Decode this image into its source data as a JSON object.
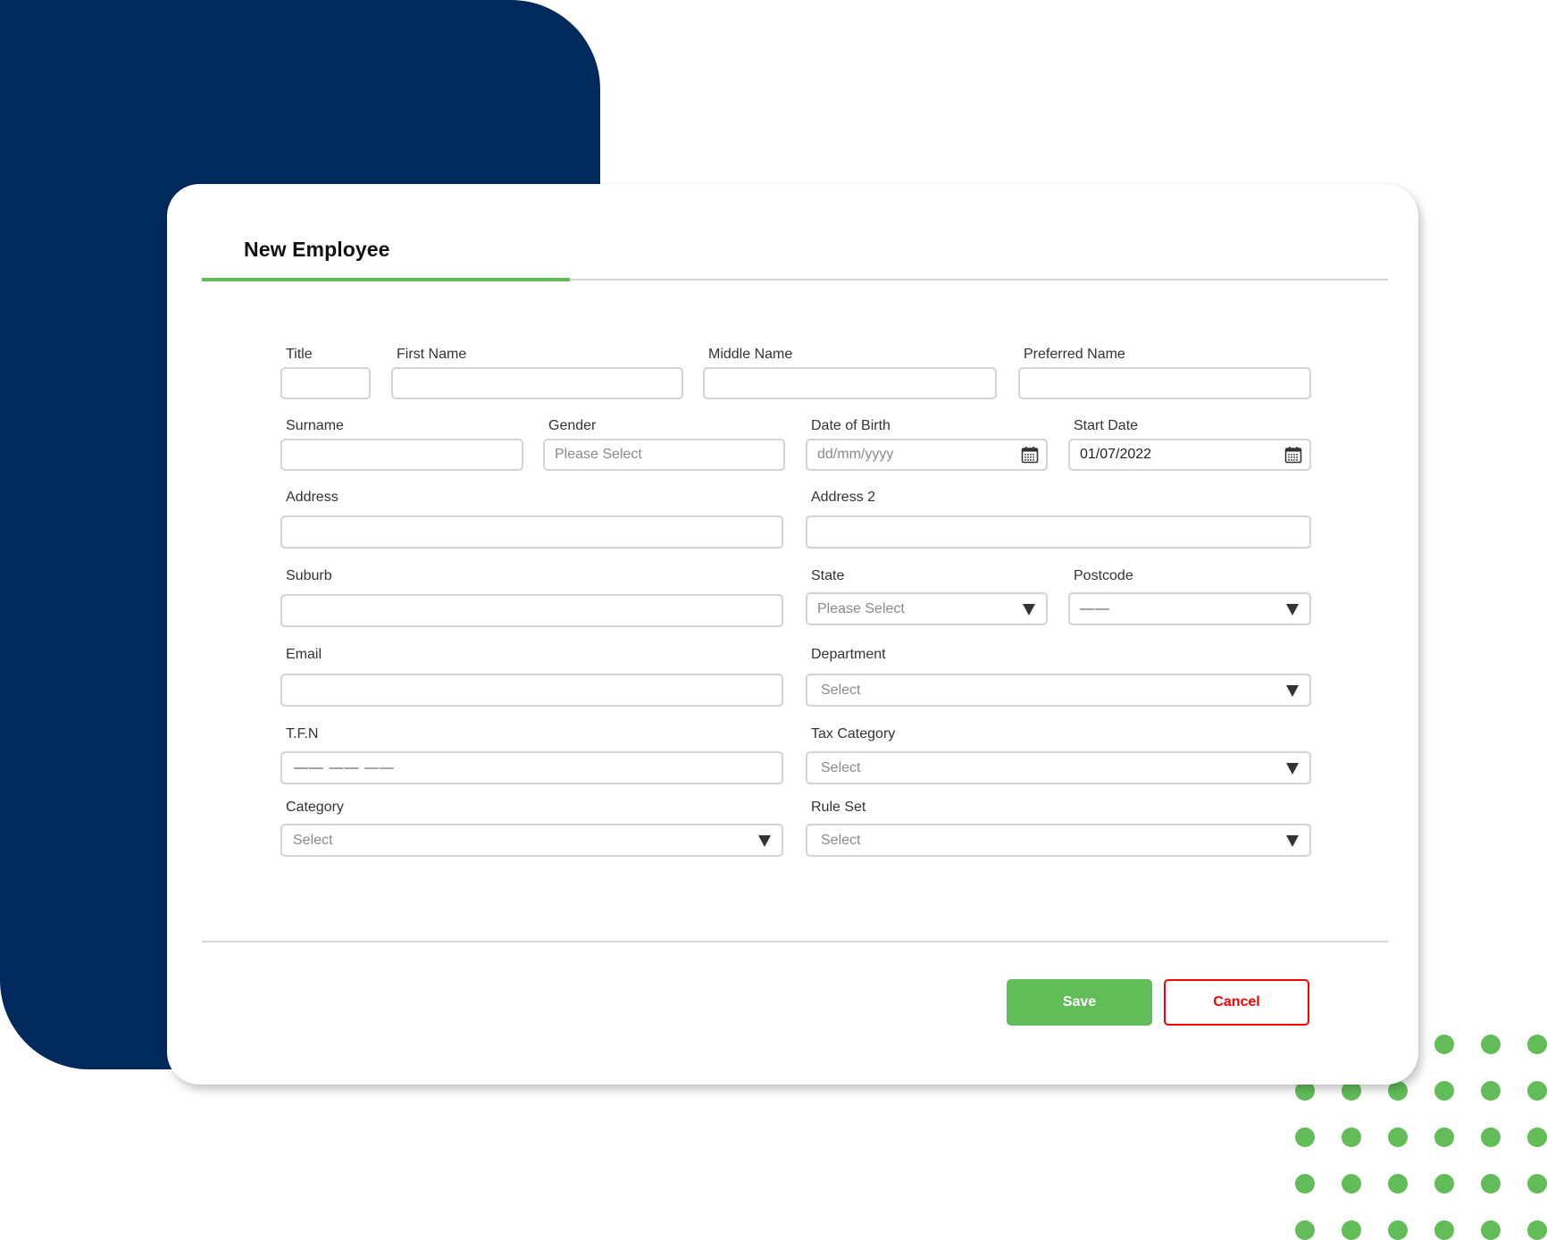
{
  "colors": {
    "navy": "#012a5c",
    "accent_green": "#62bd59",
    "cancel_red": "#ff0000"
  },
  "form": {
    "title": "New Employee",
    "progress_fraction": 0.31,
    "fields": {
      "title": {
        "label": "Title",
        "value": ""
      },
      "first_name": {
        "label": "First Name",
        "value": ""
      },
      "middle_name": {
        "label": "Middle Name",
        "value": ""
      },
      "preferred_name": {
        "label": "Preferred Name",
        "value": ""
      },
      "surname": {
        "label": "Surname",
        "value": ""
      },
      "gender": {
        "label": "Gender",
        "placeholder": "Please Select"
      },
      "date_of_birth": {
        "label": "Date of Birth",
        "placeholder": "dd/mm/yyyy",
        "icon": "calendar-icon"
      },
      "start_date": {
        "label": "Start Date",
        "value": "01/07/2022",
        "icon": "calendar-icon"
      },
      "address": {
        "label": "Address",
        "value": ""
      },
      "address2": {
        "label": "Address 2",
        "value": ""
      },
      "suburb": {
        "label": "Suburb",
        "value": ""
      },
      "state": {
        "label": "State",
        "placeholder": "Please Select",
        "icon": "dropdown-arrow-icon"
      },
      "postcode": {
        "label": "Postcode",
        "value": "——",
        "icon": "dropdown-arrow-icon"
      },
      "email": {
        "label": "Email",
        "value": ""
      },
      "department": {
        "label": "Department",
        "placeholder": "Select",
        "icon": "dropdown-arrow-icon"
      },
      "tfn": {
        "label": "T.F.N",
        "value": "—— —— ——"
      },
      "tax_category": {
        "label": "Tax Category",
        "placeholder": "Select",
        "icon": "dropdown-arrow-icon"
      },
      "category": {
        "label": "Category",
        "placeholder": "Select",
        "icon": "dropdown-arrow-icon"
      },
      "rule_set": {
        "label": "Rule Set",
        "placeholder": "Select",
        "icon": "dropdown-arrow-icon"
      }
    }
  },
  "actions": {
    "save_label": "Save",
    "cancel_label": "Cancel"
  }
}
